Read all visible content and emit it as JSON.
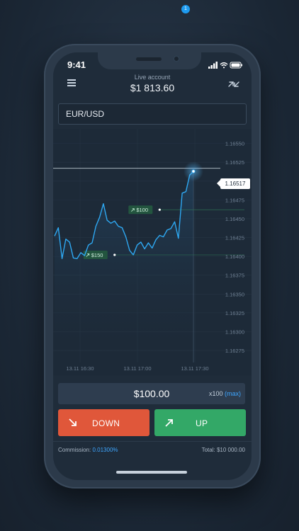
{
  "status_bar": {
    "time": "9:41"
  },
  "header": {
    "account_label": "Live account",
    "balance": "$1 813.60",
    "notification_count": "1"
  },
  "asset": {
    "pair": "EUR/USD"
  },
  "chart_data": {
    "type": "line",
    "y_ticks": [
      "1.16550",
      "1.16525",
      "1.16500",
      "1.16475",
      "1.16450",
      "1.16425",
      "1.16400",
      "1.16375",
      "1.16350",
      "1.16325",
      "1.16300",
      "1.16275"
    ],
    "x_ticks": [
      "13.11 16:30",
      "13.11 17:00",
      "13.11 17:30"
    ],
    "ylim": [
      1.1626,
      1.1656
    ],
    "current_price": "1.16517",
    "series": [
      {
        "values": [
          1.16427,
          1.16438,
          1.16397,
          1.16423,
          1.16419,
          1.16398,
          1.16397,
          1.16405,
          1.16401,
          1.16415,
          1.16418,
          1.1644,
          1.16452,
          1.1647,
          1.16448,
          1.16444,
          1.16447,
          1.1644,
          1.16438,
          1.16426,
          1.16408,
          1.16402,
          1.16415,
          1.16419,
          1.1641,
          1.16418,
          1.16411,
          1.16422,
          1.16428,
          1.16426,
          1.16435,
          1.16437,
          1.16446,
          1.16424,
          1.16484,
          1.16486,
          1.16508,
          1.16513
        ]
      }
    ],
    "trades": [
      {
        "label": "$100",
        "direction": "up",
        "price": 1.16462
      },
      {
        "label": "$150",
        "direction": "up",
        "price": 1.16402
      }
    ],
    "grid": true
  },
  "trade": {
    "amount": "$100.00",
    "multiplier": "x100",
    "max_label": "(max)",
    "down_label": "DOWN",
    "up_label": "UP"
  },
  "footer": {
    "commission_label": "Commission:",
    "commission_value": "0.01300%",
    "total": "Total: $10 000.00"
  },
  "colors": {
    "line": "#2ea8f2",
    "down": "#e0573a",
    "up": "#33a867",
    "accent": "#3ea6ff"
  }
}
